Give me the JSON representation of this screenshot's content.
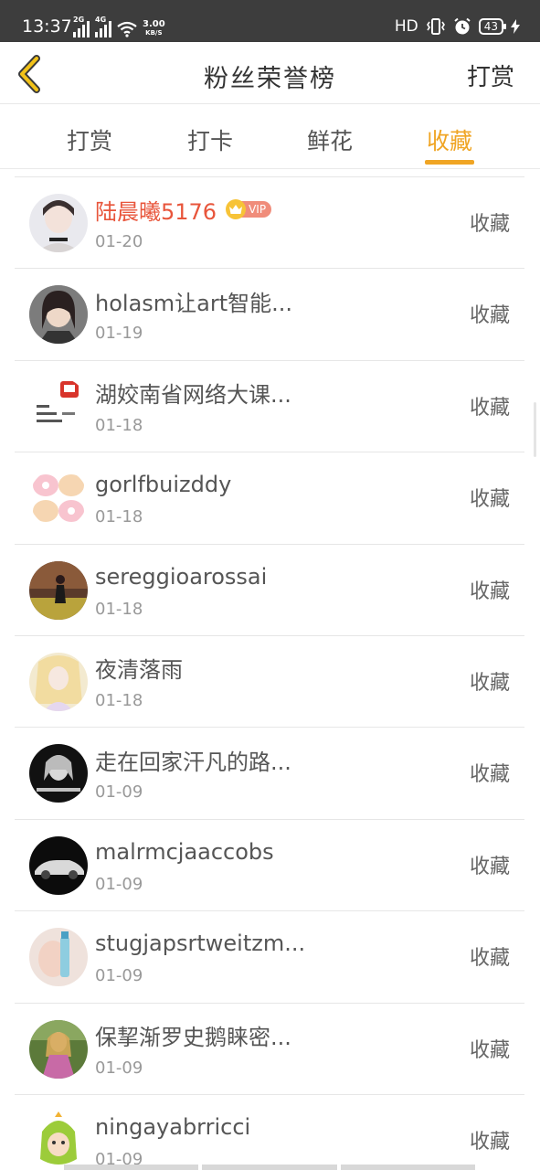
{
  "status_bar": {
    "time": "13:37",
    "net1": "2G",
    "net2": "4G",
    "speed_value": "3.00",
    "speed_unit": "KB/S",
    "hd": "HD",
    "battery": "43"
  },
  "header": {
    "title": "粉丝荣誉榜",
    "action_label": "打赏"
  },
  "tabs": [
    {
      "label": "打赏",
      "active": false
    },
    {
      "label": "打卡",
      "active": false
    },
    {
      "label": "鲜花",
      "active": false
    },
    {
      "label": "收藏",
      "active": true
    }
  ],
  "vip_label": "VIP",
  "list": [
    {
      "name": "陆晨曦5176",
      "date": "01-20",
      "action": "收藏",
      "vip": true
    },
    {
      "name": "holasm让art智能...",
      "date": "01-19",
      "action": "收藏"
    },
    {
      "name": "湖姣南省网络大课...",
      "date": "01-18",
      "action": "收藏"
    },
    {
      "name": "gorlfbuizddy",
      "date": "01-18",
      "action": "收藏"
    },
    {
      "name": "sereggioarossai",
      "date": "01-18",
      "action": "收藏"
    },
    {
      "name": "夜清落雨",
      "date": "01-18",
      "action": "收藏"
    },
    {
      "name": "走在回家汗凡的路...",
      "date": "01-09",
      "action": "收藏"
    },
    {
      "name": "malrmcjaaccobs",
      "date": "01-09",
      "action": "收藏"
    },
    {
      "name": "stugjapsrtweitzm...",
      "date": "01-09",
      "action": "收藏"
    },
    {
      "name": "保挈渐罗史鹅睐密...",
      "date": "01-09",
      "action": "收藏"
    },
    {
      "name": "ningayabrricci",
      "date": "01-09",
      "action": "收藏"
    }
  ],
  "colors": {
    "accent": "#f0a524",
    "vip_name": "#e8553b",
    "status_bar": "#3d3d3d"
  }
}
